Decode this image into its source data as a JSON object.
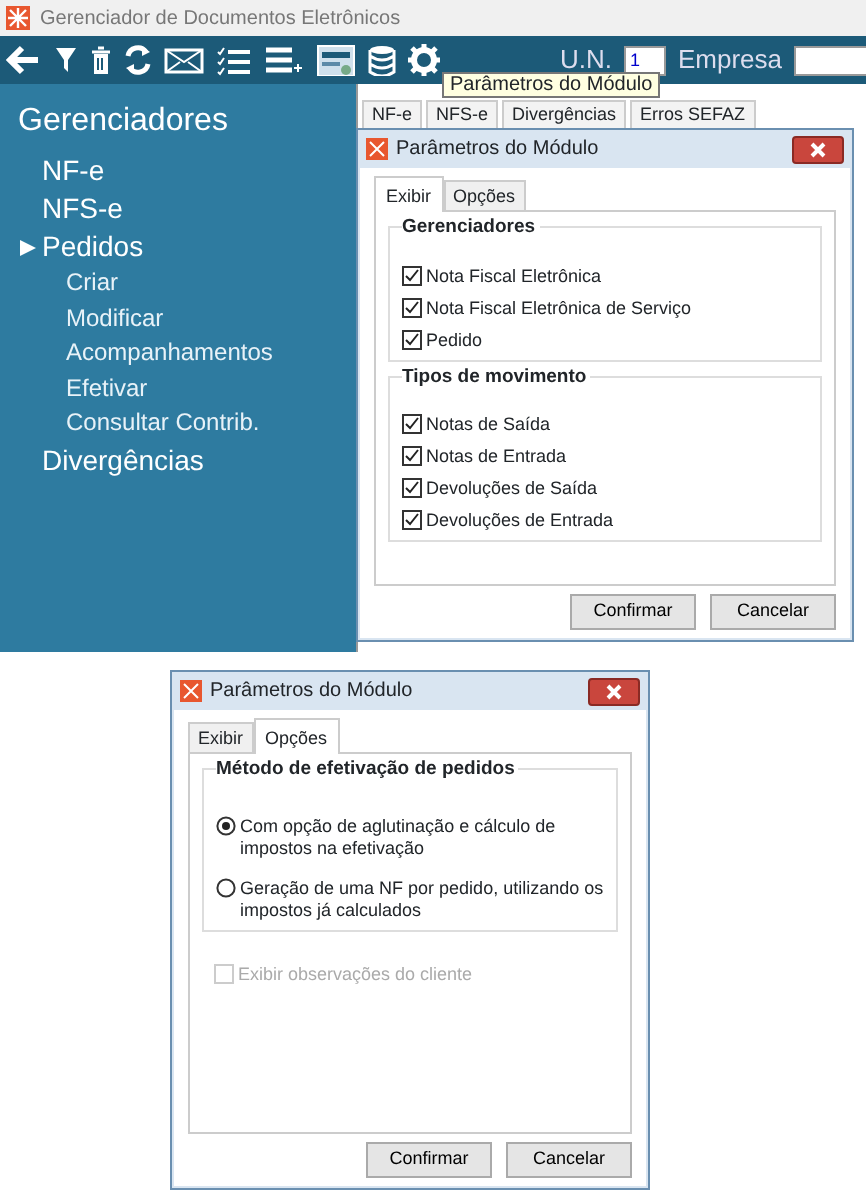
{
  "window": {
    "title": "Gerenciador de Documentos Eletrônicos"
  },
  "toolbar": {
    "un_label": "U.N.",
    "un_value": "1",
    "empresa_label": "Empresa"
  },
  "tooltip": "Parâmetros do Módulo",
  "sidebar": {
    "title": "Gerenciadores",
    "items": [
      {
        "label": "NF-e",
        "expanded": false
      },
      {
        "label": "NFS-e",
        "expanded": false
      },
      {
        "label": "Pedidos",
        "expanded": true,
        "children": [
          {
            "label": "Criar"
          },
          {
            "label": "Modificar"
          },
          {
            "label": "Acompanhamentos"
          },
          {
            "label": "Efetivar"
          },
          {
            "label": "Consultar Contrib."
          }
        ]
      },
      {
        "label": "Divergências",
        "expanded": false
      }
    ]
  },
  "tabs": [
    {
      "label": "NF-e"
    },
    {
      "label": "NFS-e"
    },
    {
      "label": "Divergências"
    },
    {
      "label": "Erros SEFAZ"
    }
  ],
  "dialogs": [
    {
      "title": "Parâmetros do Módulo",
      "tabs": [
        {
          "label": "Exibir",
          "selected": true
        },
        {
          "label": "Opções",
          "selected": false
        }
      ],
      "groups": [
        {
          "title": "Gerenciadores",
          "items": [
            {
              "kind": "checkbox",
              "label": "Nota Fiscal Eletrônica",
              "checked": true,
              "disabled": false
            },
            {
              "kind": "checkbox",
              "label": "Nota Fiscal Eletrônica de Serviço",
              "checked": true,
              "disabled": false
            },
            {
              "kind": "checkbox",
              "label": "Pedido",
              "checked": true,
              "disabled": false
            }
          ]
        },
        {
          "title": "Tipos de movimento",
          "items": [
            {
              "kind": "checkbox",
              "label": "Notas de Saída",
              "checked": true,
              "disabled": false
            },
            {
              "kind": "checkbox",
              "label": "Notas de Entrada",
              "checked": true,
              "disabled": false
            },
            {
              "kind": "checkbox",
              "label": "Devoluções de Saída",
              "checked": true,
              "disabled": false
            },
            {
              "kind": "checkbox",
              "label": "Devoluções de Entrada",
              "checked": true,
              "disabled": false
            }
          ]
        }
      ],
      "buttons": [
        "Confirmar",
        "Cancelar"
      ]
    },
    {
      "title": "Parâmetros do Módulo",
      "tabs": [
        {
          "label": "Exibir",
          "selected": false
        },
        {
          "label": "Opções",
          "selected": true
        }
      ],
      "groups": [
        {
          "title": "Método de efetivação de pedidos",
          "items": [
            {
              "kind": "radio",
              "label": "Com opção de aglutinação e cálculo de impostos na efetivação",
              "checked": true,
              "disabled": false
            },
            {
              "kind": "radio",
              "label": "Geração de uma NF por pedido, utilizando os impostos já calculados",
              "checked": false,
              "disabled": false
            }
          ]
        }
      ],
      "extra_options": [
        {
          "kind": "checkbox",
          "label": "Exibir observações do cliente",
          "checked": false,
          "disabled": true
        }
      ],
      "buttons": [
        "Confirmar",
        "Cancelar"
      ]
    }
  ]
}
